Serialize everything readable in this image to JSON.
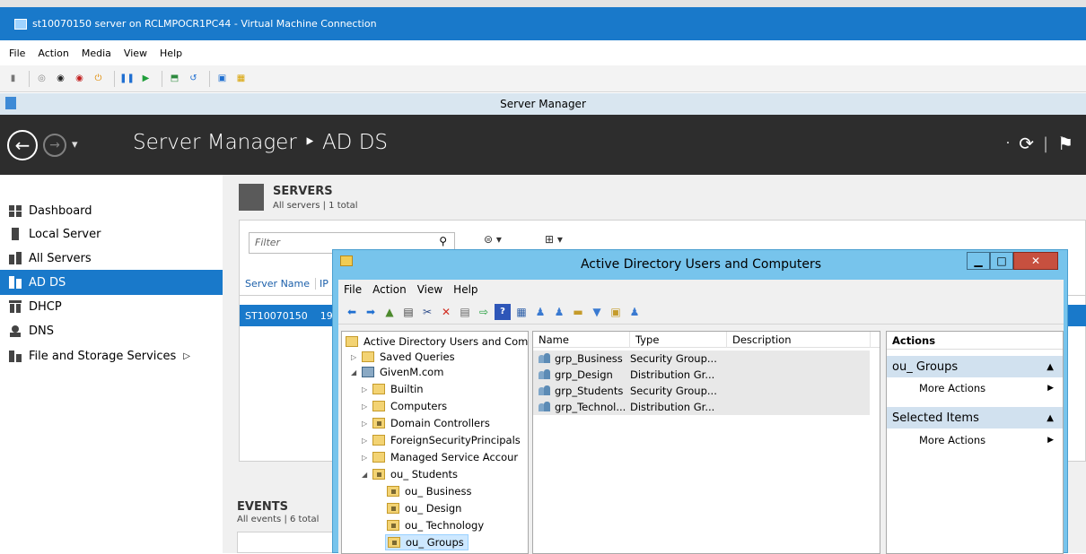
{
  "vm_window": {
    "title": "st10070150 server on RCLMPOCR1PC44 - Virtual Machine Connection",
    "menu": [
      "File",
      "Action",
      "Media",
      "View",
      "Help"
    ]
  },
  "server_manager": {
    "window_title": "Server Manager",
    "breadcrumb": "Server Manager ‣ AD DS",
    "nav": [
      {
        "label": "Dashboard",
        "icon": "dashboard-icon"
      },
      {
        "label": "Local Server",
        "icon": "local-server-icon"
      },
      {
        "label": "All Servers",
        "icon": "all-servers-icon"
      },
      {
        "label": "AD DS",
        "icon": "ad-ds-icon",
        "active": true
      },
      {
        "label": "DHCP",
        "icon": "dhcp-icon"
      },
      {
        "label": "DNS",
        "icon": "dns-icon"
      },
      {
        "label": "File and Storage Services",
        "icon": "file-storage-icon",
        "chevron": "▷"
      }
    ],
    "servers": {
      "title": "SERVERS",
      "subtitle": "All servers | 1 total",
      "filter_placeholder": "Filter",
      "col_server_name": "Server Name",
      "col_ip": "IP",
      "row_server": "ST10070150",
      "row_ip": "19"
    },
    "events": {
      "title": "EVENTS",
      "subtitle": "All events | 6 total"
    }
  },
  "aduc": {
    "title": "Active Directory Users and Computers",
    "menu": [
      "File",
      "Action",
      "View",
      "Help"
    ],
    "tree": [
      {
        "label": "Active Directory Users and Com",
        "indent": 0,
        "exp": "",
        "kind": "root"
      },
      {
        "label": "Saved Queries",
        "indent": 1,
        "exp": "▷",
        "kind": "folder"
      },
      {
        "label": "GivenM.com",
        "indent": 1,
        "exp": "◢",
        "kind": "domain"
      },
      {
        "label": "Builtin",
        "indent": 2,
        "exp": "▷",
        "kind": "folder"
      },
      {
        "label": "Computers",
        "indent": 2,
        "exp": "▷",
        "kind": "folder"
      },
      {
        "label": "Domain Controllers",
        "indent": 2,
        "exp": "▷",
        "kind": "ou"
      },
      {
        "label": "ForeignSecurityPrincipals",
        "indent": 2,
        "exp": "▷",
        "kind": "folder"
      },
      {
        "label": "Managed Service Accour",
        "indent": 2,
        "exp": "▷",
        "kind": "folder"
      },
      {
        "label": "ou_ Students",
        "indent": 2,
        "exp": "◢",
        "kind": "ou"
      },
      {
        "label": "ou_ Business",
        "indent": 3,
        "exp": "",
        "kind": "ou"
      },
      {
        "label": "ou_ Design",
        "indent": 3,
        "exp": "",
        "kind": "ou"
      },
      {
        "label": "ou_ Technology",
        "indent": 3,
        "exp": "",
        "kind": "ou"
      },
      {
        "label": "ou_ Groups",
        "indent": 3,
        "exp": "",
        "kind": "ou",
        "selected": true
      }
    ],
    "list_headers": [
      "Name",
      "Type",
      "Description"
    ],
    "rows": [
      {
        "name": "grp_Business",
        "type": "Security Group..."
      },
      {
        "name": "grp_Design",
        "type": "Distribution Gr..."
      },
      {
        "name": "grp_Students",
        "type": "Security Group..."
      },
      {
        "name": "grp_Technol...",
        "type": "Distribution Gr..."
      }
    ],
    "actions": {
      "header": "Actions",
      "group1": "ou_ Groups",
      "group1_item": "More Actions",
      "group2": "Selected Items",
      "group2_item": "More Actions"
    }
  }
}
